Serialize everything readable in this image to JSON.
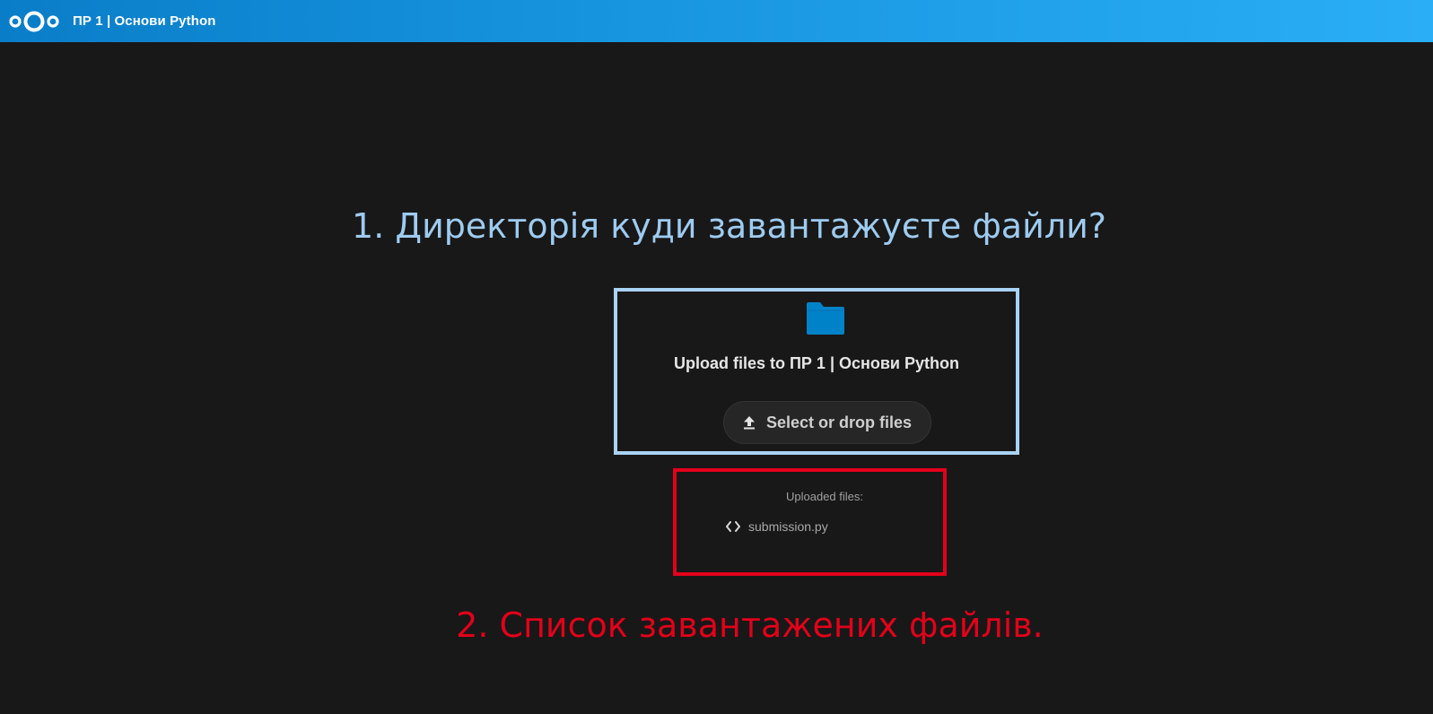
{
  "header": {
    "logo_icon": "nextcloud-logo-icon",
    "title": "ПР 1 | Основи Python"
  },
  "annotations": {
    "step1": "1. Директорія куди завантажуєте файли?",
    "step2": "2. Список завантажених файлів.",
    "colors": {
      "step1": "#9ecbf0",
      "step2": "#e2001a"
    }
  },
  "upload": {
    "folder_icon": "folder-icon",
    "title": "Upload files to ПР 1 | Основи Python",
    "button_icon": "upload-icon",
    "button_label": "Select or drop files"
  },
  "uploaded": {
    "label": "Uploaded files:",
    "files": [
      {
        "icon": "code-icon",
        "name": "submission.py"
      }
    ]
  }
}
